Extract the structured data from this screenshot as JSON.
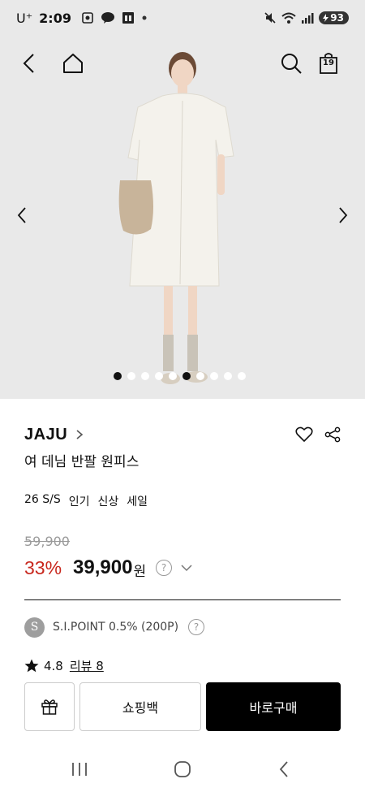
{
  "status_bar": {
    "carrier": "U⁺",
    "time": "2:09",
    "battery": "93",
    "icons": [
      "screenshot-icon",
      "talk-icon",
      "app-icon",
      "dot-icon",
      "mute-icon",
      "wifi-icon",
      "signal-icon",
      "battery-icon"
    ]
  },
  "hero": {
    "cart_count": "19",
    "slide_count": 10,
    "active_slide": 5
  },
  "product": {
    "brand": "JAJU",
    "name": "여 데님 반팔 원피스",
    "tags": [
      "26 S/S",
      "인기",
      "신상",
      "세일"
    ],
    "original_price": "59,900",
    "discount": "33%",
    "price": "39,900",
    "currency": "원",
    "help_symbol": "?"
  },
  "point": {
    "badge": "S",
    "text": "S.I.POINT 0.5% (200P)"
  },
  "rating": {
    "score": "4.8",
    "review_label": "리뷰 8"
  },
  "actions": {
    "shopping_bag": "쇼핑백",
    "buy_now": "바로구매"
  },
  "colors": {
    "discount": "#c8281e",
    "buy_button": "#000000",
    "hero_bg": "#e9e9e9"
  }
}
